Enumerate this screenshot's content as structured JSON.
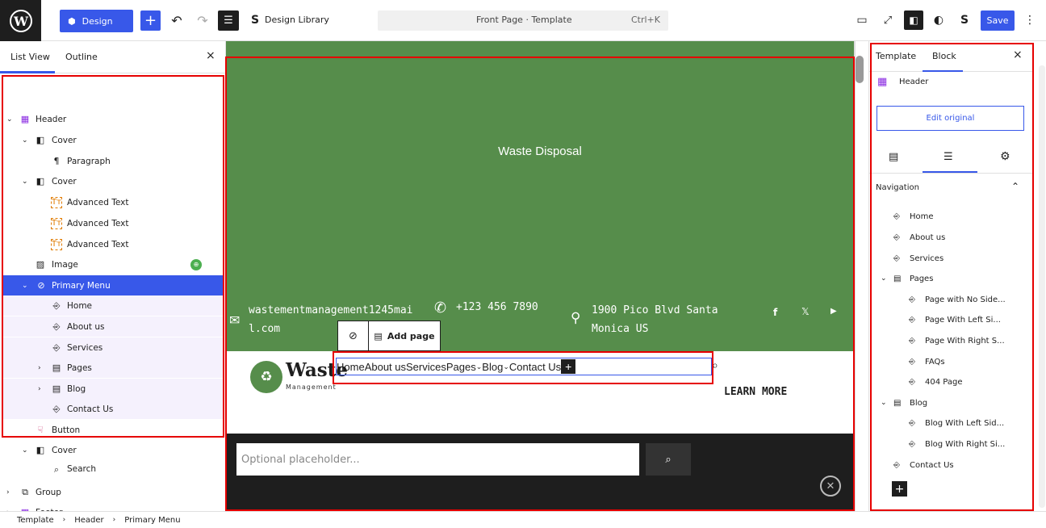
{
  "topbar": {
    "design_label": "Design",
    "library_label": "Design Library",
    "command_title": "Front Page · Template",
    "command_shortcut": "Ctrl+K",
    "save_label": "Save"
  },
  "left_panel": {
    "tab_list": "List View",
    "tab_outline": "Outline",
    "items": [
      {
        "label": "Header"
      },
      {
        "label": "Cover"
      },
      {
        "label": "Paragraph"
      },
      {
        "label": "Cover"
      },
      {
        "label": "Advanced Text"
      },
      {
        "label": "Advanced Text"
      },
      {
        "label": "Advanced Text"
      },
      {
        "label": "Image"
      },
      {
        "label": "Primary Menu"
      },
      {
        "label": "Home"
      },
      {
        "label": "About us"
      },
      {
        "label": "Services"
      },
      {
        "label": "Pages"
      },
      {
        "label": "Blog"
      },
      {
        "label": "Contact Us"
      },
      {
        "label": "Button"
      },
      {
        "label": "Cover"
      },
      {
        "label": "Search"
      },
      {
        "label": "Group"
      },
      {
        "label": "Footer"
      }
    ]
  },
  "canvas": {
    "hero_title": "Waste Disposal",
    "email": "wastementmanagement1245mai\nl.com",
    "phone": "+123 456 7890",
    "address": "1900 Pico Blvd Santa\nMonica US",
    "add_page": "Add page",
    "logo_text": "Waste",
    "logo_sub": "Management",
    "menu": [
      "Home",
      "About us",
      "Services",
      "Pages",
      "Blog",
      "Contact Us"
    ],
    "learn_more": "LEARN MORE",
    "search_placeholder": "Optional placeholder..."
  },
  "right_panel": {
    "tab_template": "Template",
    "tab_block": "Block",
    "block_name": "Header",
    "edit_original": "Edit original",
    "section_title": "Navigation",
    "nav_items": [
      {
        "label": "Home"
      },
      {
        "label": "About us"
      },
      {
        "label": "Services"
      },
      {
        "label": "Pages"
      },
      {
        "label": "Page with No Side..."
      },
      {
        "label": "Page With Left Si..."
      },
      {
        "label": "Page With Right S..."
      },
      {
        "label": "FAQs"
      },
      {
        "label": "404 Page"
      },
      {
        "label": "Blog"
      },
      {
        "label": "Blog With Left Sid..."
      },
      {
        "label": "Blog With Right Si..."
      },
      {
        "label": "Contact Us"
      }
    ]
  },
  "breadcrumb": [
    "Template",
    "Header",
    "Primary Menu"
  ],
  "colors": {
    "accent": "#3858e9",
    "hero_green": "#568d4b",
    "highlight_red": "#e60000"
  }
}
